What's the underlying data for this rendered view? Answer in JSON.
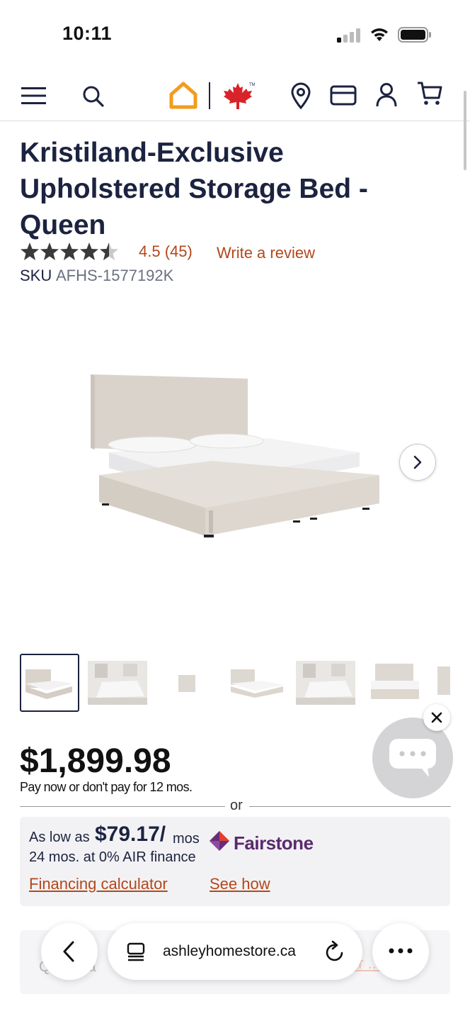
{
  "status_bar": {
    "time": "10:11"
  },
  "header": {
    "menu_icon": "hamburger-menu-icon",
    "search_icon": "search-icon",
    "logo_icon": "home-logo-icon",
    "flag_icon": "maple-leaf-icon",
    "tm": "TM",
    "store_icon": "location-pin-icon",
    "card_icon": "credit-card-icon",
    "account_icon": "account-icon",
    "cart_icon": "cart-icon",
    "accent_color": "#f39c1f"
  },
  "product": {
    "title": "Kristiland-Exclusive Upholstered Storage Bed - Queen",
    "rating_value": 4.5,
    "rating_text": "4.5 (45)",
    "write_review": "Write a review",
    "sku_label": "SKU",
    "sku_value": "AFHS-1577192K",
    "price": "$1,899.98",
    "pay_note": "Pay now or don't pay for 12 mos.",
    "or": "or"
  },
  "financing": {
    "as_low_as": "As low as",
    "monthly": "$79.17/",
    "mos": "mos",
    "terms": "24 mos. at 0% AIR finance",
    "brand": "Fairstone",
    "calculator_link": "Financing calculator",
    "see_how_link": "See how"
  },
  "gallery": {
    "thumb_count": 7,
    "selected_index": 0
  },
  "below_fold": {
    "qty_text": "Q ... qua",
    "link_text": "Car ... ge"
  },
  "browser": {
    "url": "ashleyhomestore.ca"
  },
  "colors": {
    "link": "#b3471b",
    "text": "#1c2340",
    "brand_orange": "#f39c1f",
    "flag_red": "#d8232a"
  }
}
